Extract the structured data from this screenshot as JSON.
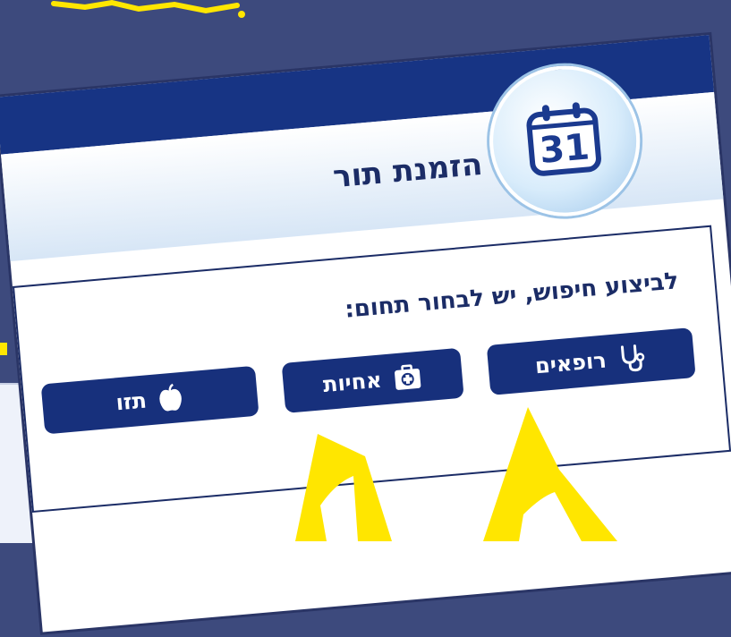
{
  "page": {
    "title": "הזמנת תור",
    "prompt": "לביצוע חיפוש, יש לבחור תחום:"
  },
  "calendar": {
    "day": "31",
    "icon": "calendar-icon"
  },
  "buttons": [
    {
      "label": "רופאים",
      "icon": "stethoscope-icon"
    },
    {
      "label": "אחיות",
      "icon": "first-aid-kit-icon"
    },
    {
      "label": "תזו",
      "icon": "apple-icon"
    }
  ],
  "colors": {
    "background": "#3d4a7d",
    "header": "#173484",
    "button": "#17307c",
    "accent_yellow": "#ffe600",
    "title_text": "#1b2c66"
  }
}
